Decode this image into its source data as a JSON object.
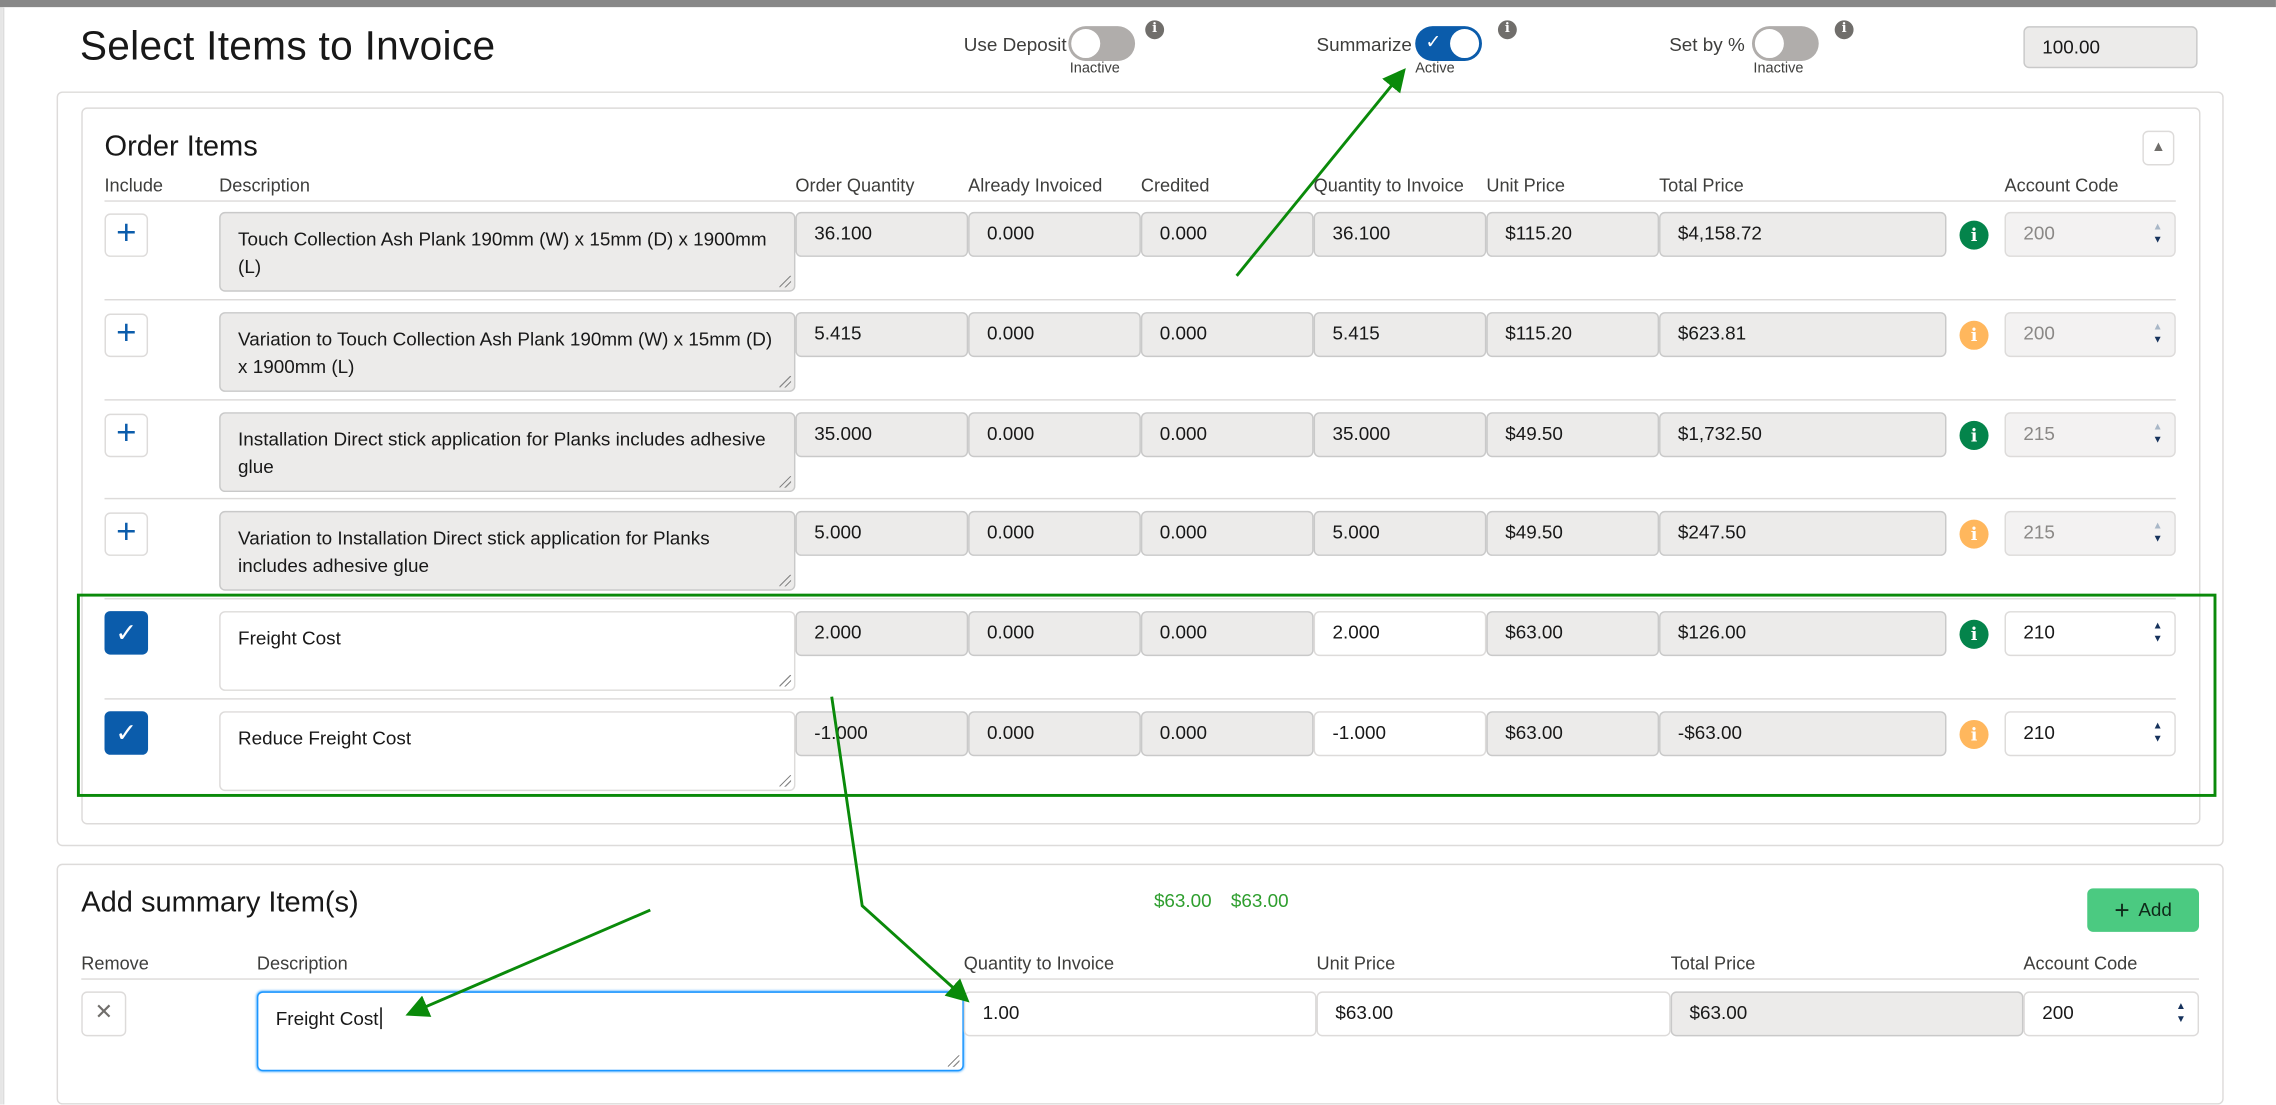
{
  "header": {
    "title": "Select Items to Invoice",
    "toggles": [
      {
        "label": "Use Deposit",
        "state": "Inactive",
        "on": false
      },
      {
        "label": "Summarize",
        "state": "Active",
        "on": true
      },
      {
        "label": "Set by %",
        "state": "Inactive",
        "on": false
      }
    ],
    "percent_value": "100.00"
  },
  "order_items": {
    "title": "Order Items",
    "columns": [
      "Include",
      "Description",
      "Order Quantity",
      "Already Invoiced",
      "Credited",
      "Quantity to Invoice",
      "Unit Price",
      "Total Price",
      "Account Code"
    ],
    "rows": [
      {
        "included": false,
        "description": "Touch Collection Ash Plank 190mm (W) x 15mm (D) x 1900mm (L)",
        "order_qty": "36.100",
        "already_invoiced": "0.000",
        "credited": "0.000",
        "qty_to_invoice": "36.100",
        "unit_price": "$115.20",
        "total_price": "$4,158.72",
        "info": "green",
        "account_code": "200"
      },
      {
        "included": false,
        "description": "Variation to Touch Collection Ash Plank 190mm (W) x 15mm (D) x 1900mm (L)",
        "order_qty": "5.415",
        "already_invoiced": "0.000",
        "credited": "0.000",
        "qty_to_invoice": "5.415",
        "unit_price": "$115.20",
        "total_price": "$623.81",
        "info": "orange",
        "account_code": "200"
      },
      {
        "included": false,
        "description": "Installation Direct stick application for Planks includes adhesive glue",
        "order_qty": "35.000",
        "already_invoiced": "0.000",
        "credited": "0.000",
        "qty_to_invoice": "35.000",
        "unit_price": "$49.50",
        "total_price": "$1,732.50",
        "info": "green",
        "account_code": "215"
      },
      {
        "included": false,
        "description": "Variation to Installation Direct stick application for Planks includes adhesive glue",
        "order_qty": "5.000",
        "already_invoiced": "0.000",
        "credited": "0.000",
        "qty_to_invoice": "5.000",
        "unit_price": "$49.50",
        "total_price": "$247.50",
        "info": "orange",
        "account_code": "215"
      },
      {
        "included": true,
        "description": "Freight Cost",
        "order_qty": "2.000",
        "already_invoiced": "0.000",
        "credited": "0.000",
        "qty_to_invoice": "2.000",
        "unit_price": "$63.00",
        "total_price": "$126.00",
        "info": "green",
        "account_code": "210"
      },
      {
        "included": true,
        "description": "Reduce Freight Cost",
        "order_qty": "-1.000",
        "already_invoiced": "0.000",
        "credited": "0.000",
        "qty_to_invoice": "-1.000",
        "unit_price": "$63.00",
        "total_price": "-$63.00",
        "info": "orange",
        "account_code": "210"
      }
    ]
  },
  "summary": {
    "title": "Add summary Item(s)",
    "totals": [
      "$63.00",
      "$63.00"
    ],
    "add_label": "Add",
    "columns": [
      "Remove",
      "Description",
      "Quantity to Invoice",
      "Unit Price",
      "Total Price",
      "Account Code"
    ],
    "item": {
      "description": "Freight Cost",
      "qty": "1.00",
      "unit_price": "$63.00",
      "total_price": "$63.00",
      "account_code": "200"
    }
  },
  "icons": {
    "plus": "+",
    "check": "✓",
    "info": "i",
    "remove": "✕",
    "collapse": "▲",
    "spin_up": "▲",
    "spin_down": "▼"
  },
  "colors": {
    "brand_blue": "#0b5cab",
    "info_green": "#04844b",
    "info_orange": "#ffb75d",
    "add_green": "#4bca81",
    "annotation_green": "#0a8a0a"
  }
}
